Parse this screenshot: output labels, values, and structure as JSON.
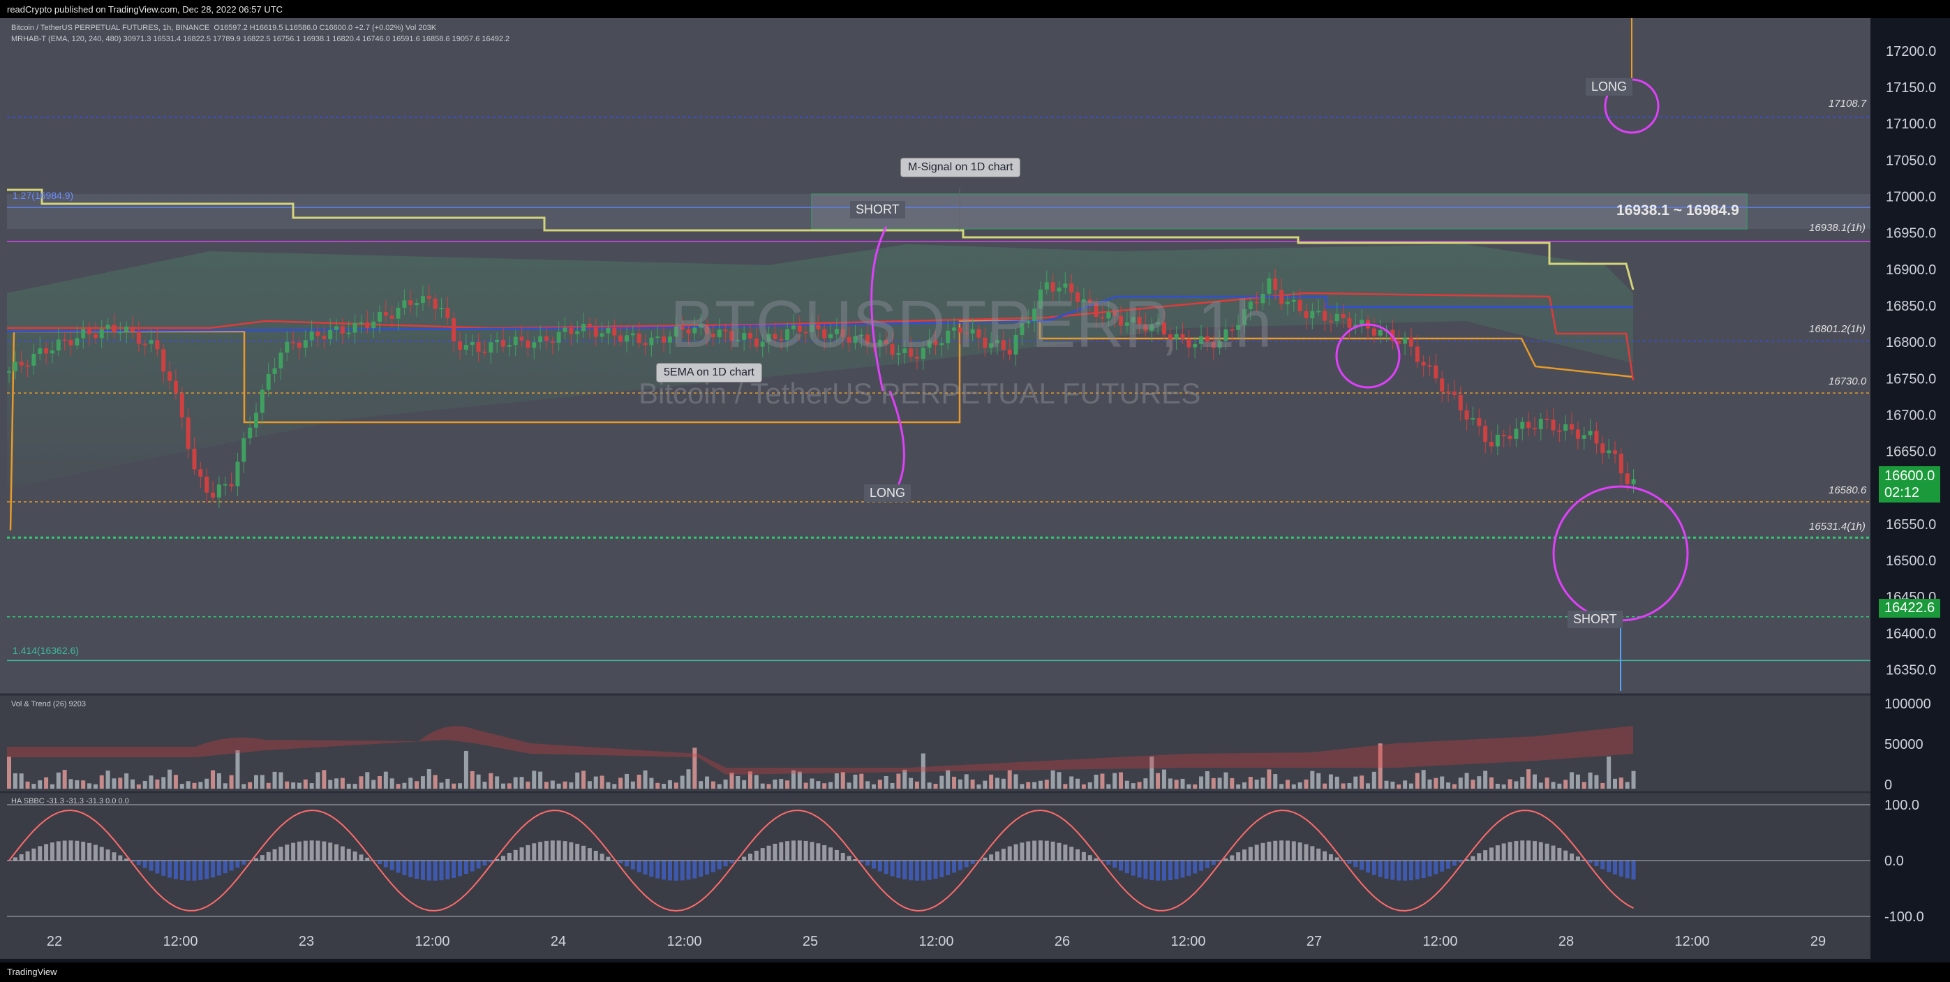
{
  "header": {
    "published": "readCrypto published on TradingView.com, Dec 28, 2022 06:57 UTC",
    "symbol_line": "Bitcoin / TetherUS PERPETUAL FUTURES, 1h, BINANCE",
    "ohlc": "O16597.2 H16619.5 L16586.0 C16600.0 +2.7 (+0.02%) Vol 203K",
    "indicator_line": "MRHAB-T (EMA, 120, 240, 480)  30971.3  16531.4  16822.5  17789.9  16822.5  16756.1  16938.1  16820.4  16746.0  16591.6  16858.6  19057.6  16492.2",
    "vol_trend_label": "Vol & Trend (26)  9203",
    "ha_sbbc_label": "HA SBBC  -31.3  -31.3  -31.3  0.0  0.0"
  },
  "footer": {
    "brand": "TradingView"
  },
  "watermark": {
    "ticker": "BTCUSDTPERP, 1h",
    "name": "Bitcoin / TetherUS PERPETUAL FUTURES"
  },
  "annotations": {
    "msignal": "M-Signal on 1D chart",
    "ema5": "5EMA on 1D chart",
    "short1": "SHORT",
    "long1": "LONG",
    "long2": "LONG",
    "short2": "SHORT",
    "zone": "16938.1 ~ 16984.9",
    "fib1": "1.27(16984.9)",
    "fib2": "1.414(16362.6)",
    "lvl_17108": "17108.7",
    "lvl_16938": "16938.1(1h)",
    "lvl_16801": "16801.2(1h)",
    "lvl_16730": "16730.0",
    "lvl_16580": "16580.6",
    "lvl_16531": "16531.4(1h)"
  },
  "price_now": {
    "price": "16600.0",
    "countdown": "02:12"
  },
  "price_green": "16422.6",
  "colors": {
    "bg": "#131722",
    "up": "#26a69a",
    "down": "#ef5350",
    "magenta": "#e040fb",
    "msignal": "#d4d47a"
  },
  "chart_data": {
    "type": "candlestick",
    "title": "Bitcoin / TetherUS PERPETUAL FUTURES, 1h, BINANCE",
    "y_ticks": [
      "17200.0",
      "17150.0",
      "17100.0",
      "17050.0",
      "17000.0",
      "16950.0",
      "16900.0",
      "16850.0",
      "16800.0",
      "16750.0",
      "16700.0",
      "16650.0",
      "16600.0",
      "16550.0",
      "16500.0",
      "16450.0",
      "16400.0",
      "16350.0"
    ],
    "ylim": [
      16315,
      17245
    ],
    "x_ticks": [
      "22",
      "12:00",
      "23",
      "12:00",
      "24",
      "12:00",
      "25",
      "12:00",
      "26",
      "12:00",
      "27",
      "12:00",
      "28",
      "12:00",
      "29"
    ],
    "close_path": [
      [
        0,
        16760
      ],
      [
        6,
        16790
      ],
      [
        12,
        16810
      ],
      [
        18,
        16820
      ],
      [
        24,
        16790
      ],
      [
        28,
        16700
      ],
      [
        30,
        16620
      ],
      [
        33,
        16590
      ],
      [
        36,
        16610
      ],
      [
        40,
        16710
      ],
      [
        44,
        16790
      ],
      [
        50,
        16810
      ],
      [
        56,
        16820
      ],
      [
        62,
        16840
      ],
      [
        66,
        16860
      ],
      [
        70,
        16850
      ],
      [
        72,
        16800
      ],
      [
        76,
        16790
      ],
      [
        80,
        16800
      ],
      [
        86,
        16800
      ],
      [
        92,
        16820
      ],
      [
        98,
        16810
      ],
      [
        104,
        16800
      ],
      [
        110,
        16820
      ],
      [
        116,
        16810
      ],
      [
        122,
        16800
      ],
      [
        128,
        16820
      ],
      [
        134,
        16810
      ],
      [
        140,
        16800
      ],
      [
        146,
        16780
      ],
      [
        150,
        16800
      ],
      [
        154,
        16820
      ],
      [
        158,
        16800
      ],
      [
        162,
        16790
      ],
      [
        166,
        16850
      ],
      [
        168,
        16880
      ],
      [
        172,
        16870
      ],
      [
        176,
        16840
      ],
      [
        180,
        16830
      ],
      [
        186,
        16820
      ],
      [
        190,
        16800
      ],
      [
        196,
        16800
      ],
      [
        200,
        16840
      ],
      [
        204,
        16880
      ],
      [
        206,
        16860
      ],
      [
        210,
        16840
      ],
      [
        216,
        16830
      ],
      [
        220,
        16820
      ],
      [
        226,
        16800
      ],
      [
        230,
        16760
      ],
      [
        234,
        16720
      ],
      [
        238,
        16680
      ],
      [
        240,
        16660
      ],
      [
        244,
        16680
      ],
      [
        248,
        16690
      ],
      [
        252,
        16680
      ],
      [
        256,
        16670
      ],
      [
        260,
        16640
      ],
      [
        262,
        16610
      ],
      [
        264,
        16600
      ]
    ],
    "levels": [
      17108.7,
      16984.9,
      16938.1,
      16801.2,
      16730.0,
      16580.6,
      16531.4,
      16422.6,
      16362.6
    ],
    "volume_panel": {
      "ylim": [
        0,
        100000
      ],
      "y_ticks": [
        "100000",
        "50000",
        "0"
      ]
    },
    "oscillator_panel": {
      "ylim": [
        -100,
        100
      ],
      "y_ticks": [
        "100.0",
        "0.0",
        "-100.0"
      ]
    }
  }
}
